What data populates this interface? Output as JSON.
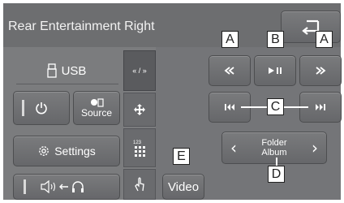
{
  "header": {
    "title": "Rear Entertainment Right"
  },
  "left_panel": {
    "usb_label": "USB",
    "source_label": "Source",
    "settings_label": "Settings"
  },
  "controls": {
    "folder_line1": "Folder",
    "folder_line2": "Album",
    "video_label": "Video"
  },
  "callouts": {
    "a": "A",
    "b": "B",
    "c": "C",
    "d": "D",
    "e": "E"
  },
  "icons": {
    "back": "back-arrow-icon",
    "usb": "usb-icon",
    "power": "power-icon",
    "source": "source-icon",
    "settings": "gear-icon",
    "audio_headphone": "speaker-to-headphone-icon",
    "rewind": "rewind-icon",
    "play_pause": "play-pause-icon",
    "fast_forward": "fast-forward-icon",
    "prev_track": "previous-track-icon",
    "next_track": "next-track-icon",
    "folder_prev": "chevron-left-icon",
    "folder_next": "chevron-right-icon"
  },
  "colors": {
    "screen": "#7b7c7e",
    "header": "#6d6e70",
    "text": "#ffffff"
  }
}
